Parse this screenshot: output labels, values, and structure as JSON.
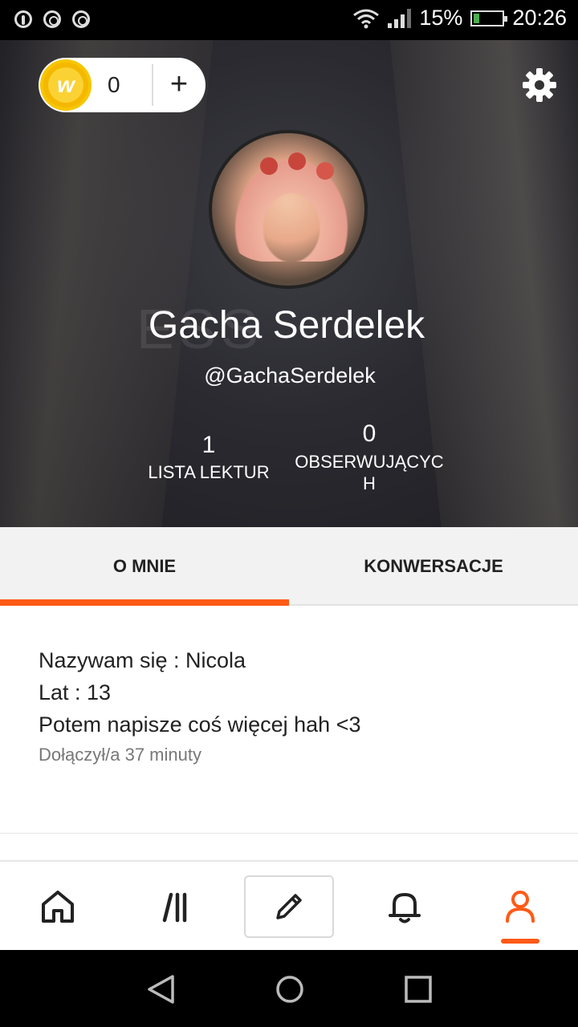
{
  "status_bar": {
    "battery": "15%",
    "time": "20:26",
    "icons": [
      "pinterest-icon",
      "chrome-icon",
      "chrome-icon",
      "wifi-icon",
      "signal-icon",
      "battery-charging-icon"
    ]
  },
  "coins": {
    "logo_letter": "w",
    "count": "0",
    "add_label": "+"
  },
  "profile": {
    "name": "Gacha Serdelek",
    "handle": "@GachaSerdelek",
    "stats": {
      "reading_lists": {
        "value": "1",
        "label": "LISTA LEKTUR"
      },
      "followers": {
        "value": "0",
        "label_line1": "OBSERWUJĄCYC",
        "label_line2": "H"
      }
    }
  },
  "tabs": [
    {
      "label": "O MNIE",
      "active": true
    },
    {
      "label": "KONWERSACJE",
      "active": false
    }
  ],
  "about": {
    "line1": "Nazywam się : Nicola",
    "line2": "Lat : 13",
    "line3": "Potem napisze coś więcej hah <3",
    "joined": "Dołączył/a 37 minuty"
  },
  "bottom_nav": {
    "items": [
      "home-icon",
      "library-icon",
      "write-icon",
      "notifications-bell-icon",
      "profile-icon"
    ],
    "active": "profile-icon"
  },
  "colors": {
    "accent": "#ff5a16",
    "coin": "#f5b800",
    "header_bg": "#2a2a30"
  }
}
